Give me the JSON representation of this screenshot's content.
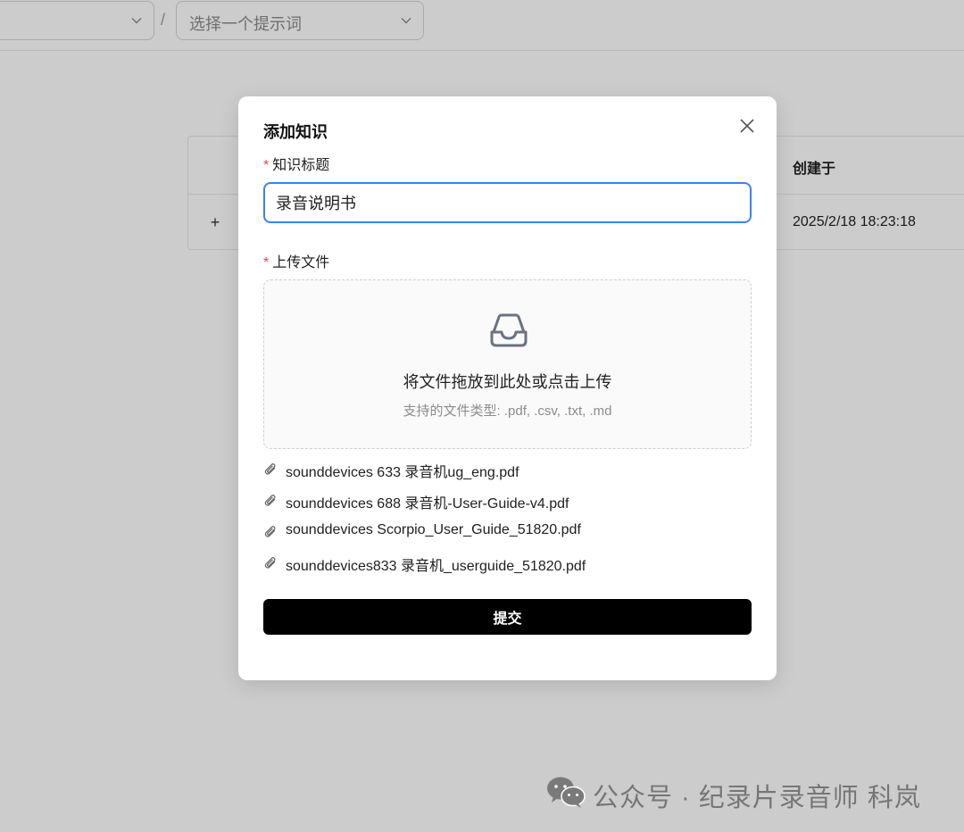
{
  "topbar": {
    "left_select": {
      "placeholder": ""
    },
    "separator": "/",
    "prompt_select": {
      "placeholder": "选择一个提示词"
    }
  },
  "table": {
    "header_created": "创建于",
    "rows": [
      {
        "expand": "+",
        "created": "2025/2/18 18:23:18"
      }
    ]
  },
  "modal": {
    "title": "添加知识",
    "title_field": {
      "required_mark": "*",
      "label": "知识标题",
      "value": "录音说明书"
    },
    "upload_field": {
      "required_mark": "*",
      "label": "上传文件",
      "dropzone_text": "将文件拖放到此处或点击上传",
      "dropzone_hint": "支持的文件类型: .pdf, .csv, .txt, .md"
    },
    "files": [
      "sounddevices 633 录音机ug_eng.pdf",
      "sounddevices 688 录音机-User-Guide-v4.pdf",
      "sounddevices Scorpio_User_Guide_51820.pdf",
      "sounddevices833 录音机_userguide_51820.pdf"
    ],
    "submit_label": "提交"
  },
  "watermark": {
    "text": "公众号 · 纪录片录音师 科岚"
  },
  "colors": {
    "focus_border": "#3b82f6",
    "required": "#e5484d",
    "primary_button": "#000000"
  },
  "icons": [
    "chevron-down-icon",
    "close-icon",
    "inbox-icon",
    "paperclip-icon",
    "wechat-icon"
  ]
}
